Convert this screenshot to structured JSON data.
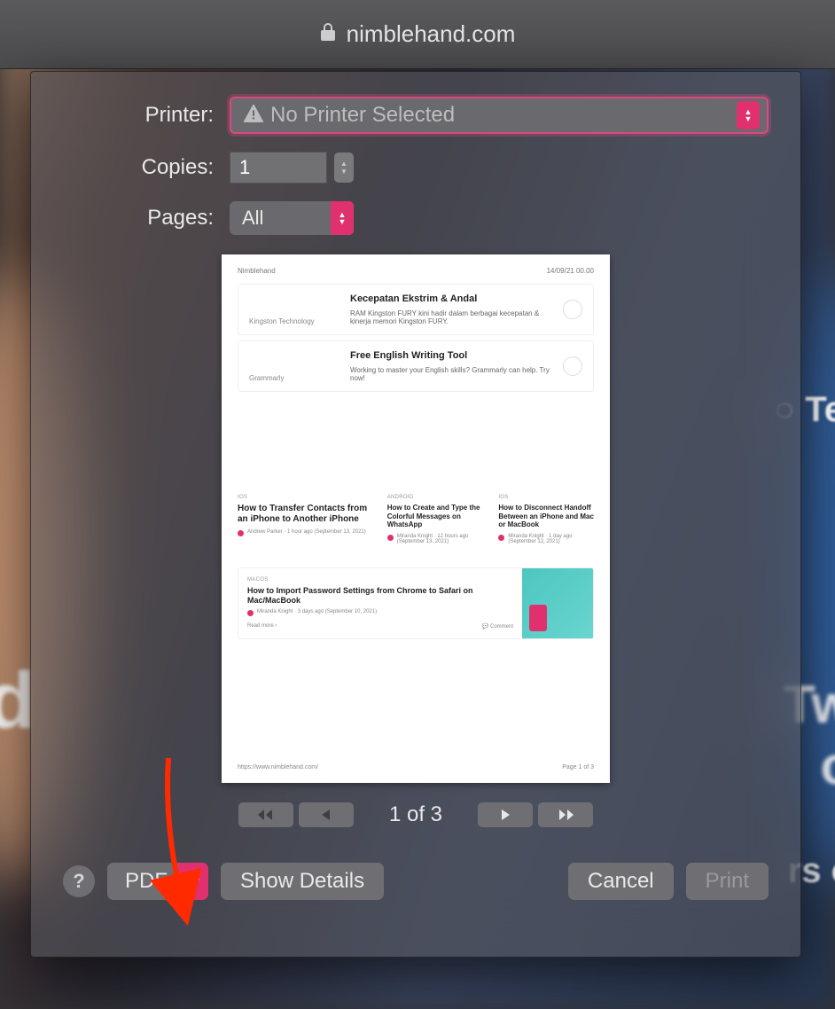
{
  "url_bar": {
    "domain": "nimblehand.com"
  },
  "dialog": {
    "printer_label": "Printer:",
    "printer_value": "No Printer Selected",
    "copies_label": "Copies:",
    "copies_value": "1",
    "pages_label": "Pages:",
    "pages_value": "All",
    "page_indicator": "1 of 3",
    "pdf_label": "PDF",
    "show_details": "Show Details",
    "cancel": "Cancel",
    "print": "Print",
    "help": "?"
  },
  "preview": {
    "header_left": "Nimblehand",
    "header_right": "14/09/21 00.00",
    "card1": {
      "brand": "Kingston Technology",
      "title": "Kecepatan Ekstrim & Andal",
      "text": "RAM Kingston FURY kini hadir dalam berbagai kecepatan & kinerja memori Kingston FURY."
    },
    "card2": {
      "brand": "Grammarly",
      "title": "Free English Writing Tool",
      "text": "Working to master your English skills? Grammarly can help. Try now!"
    },
    "articles": [
      {
        "tag": "IOS",
        "title": "How to Transfer Contacts from an iPhone to Another iPhone",
        "meta": "Andrew Parker · 1 hour ago (September 13, 2021)"
      },
      {
        "tag": "ANDROID",
        "title": "How to Create and Type the Colorful Messages on WhatsApp",
        "meta": "Miranda Knight · 12 hours ago (September 13, 2021)"
      },
      {
        "tag": "IOS",
        "title": "How to Disconnect Handoff Between an iPhone and Mac or MacBook",
        "meta": "Miranda Knight · 1 day ago (September 12, 2021)"
      }
    ],
    "bottom_card": {
      "tag": "MACOS",
      "title": "How to Import Password Settings from Chrome to Safari on Mac/MacBook",
      "meta": "Miranda Knight · 3 days ago (September 10, 2021)",
      "readmore": "Read more ›",
      "comment": "💬 Comment"
    },
    "footer_left": "https://www.nimblehand.com/",
    "footer_right": "Page 1 of 3"
  },
  "bg_fragments": {
    "left": "rd",
    "te": "○ Te",
    "tw": "Tw",
    "o": "o",
    "rs": "rs o"
  }
}
